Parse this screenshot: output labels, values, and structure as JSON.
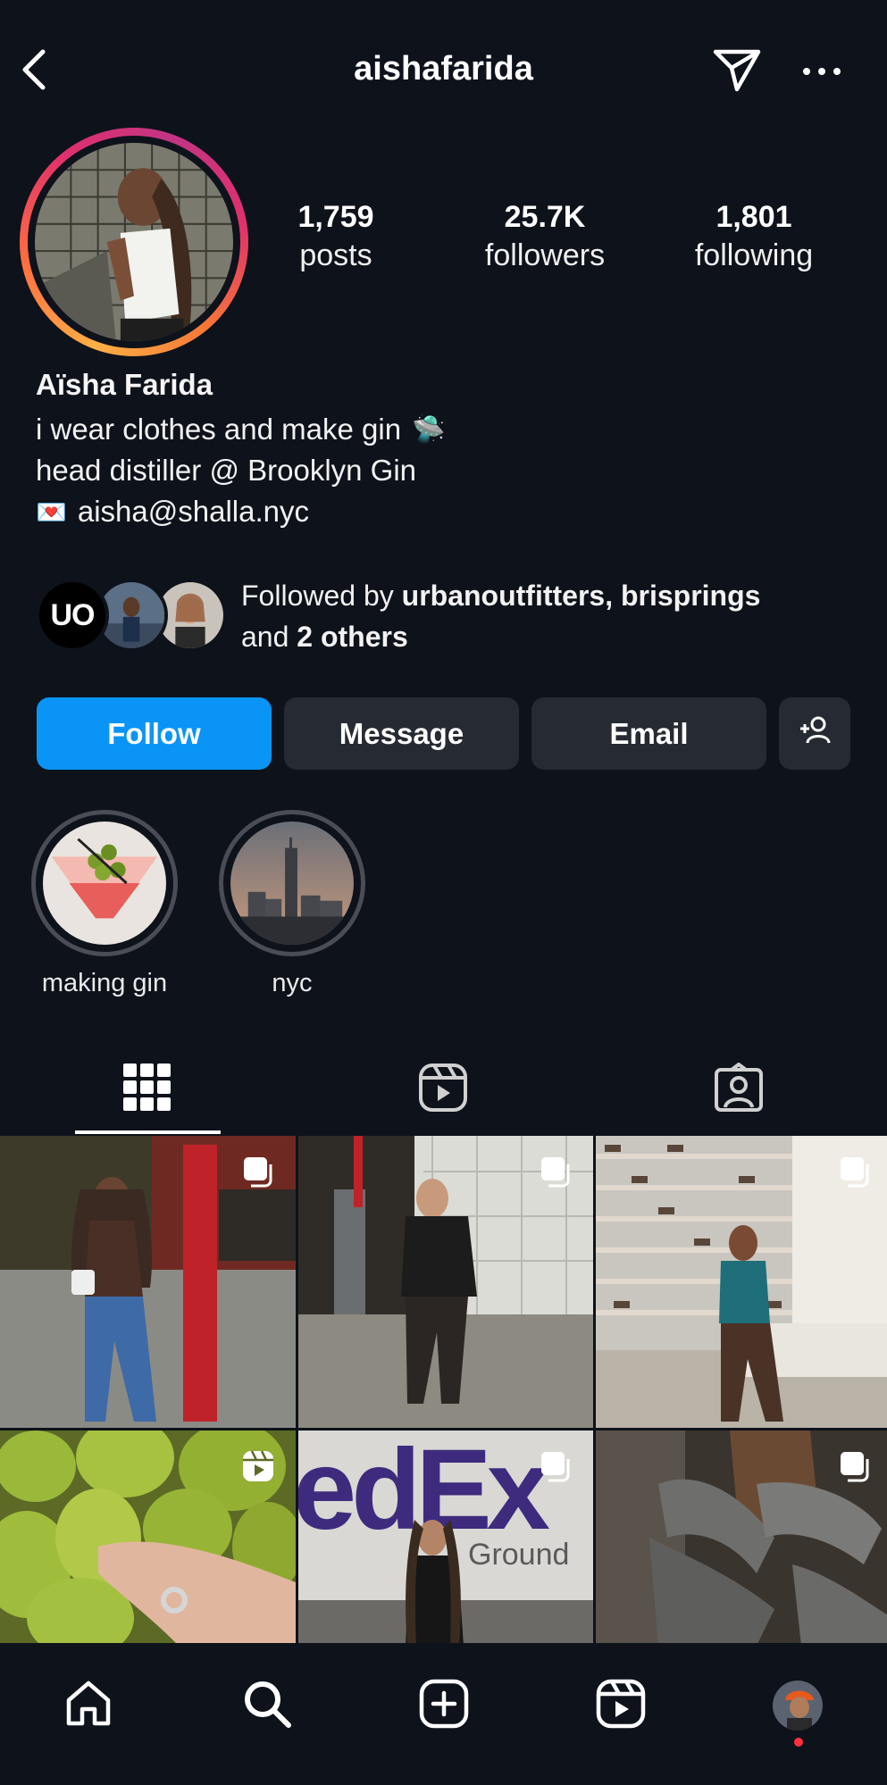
{
  "header": {
    "username": "aishafarida",
    "back_icon": "chevron-left-icon",
    "send_icon": "paper-plane-icon",
    "more_icon": "more-horizontal-icon"
  },
  "profile": {
    "stats": [
      {
        "value": "1,759",
        "label": "posts"
      },
      {
        "value": "25.7K",
        "label": "followers"
      },
      {
        "value": "1,801",
        "label": "following"
      }
    ],
    "display_name": "Aïsha Farida",
    "bio": [
      {
        "text": "i wear clothes and make gin",
        "emoji": "🛸"
      },
      {
        "text": "head distiller @ Brooklyn Gin",
        "emoji": ""
      },
      {
        "text": "aisha@shalla.nyc",
        "emoji": "💌"
      }
    ],
    "story_ring_colors": [
      "#fcaf45",
      "#e1306c",
      "#c13584"
    ]
  },
  "followed_by": {
    "prefix": "Followed by ",
    "names": "urbanoutfitters, brisprings",
    "and": " and ",
    "others": "2 others",
    "uo_logo": "UO"
  },
  "buttons": {
    "follow": "Follow",
    "message": "Message",
    "email": "Email",
    "add_user_icon": "add-user-icon",
    "follow_color": "#0a95f6"
  },
  "highlights": [
    {
      "label": "making gin"
    },
    {
      "label": "nyc"
    }
  ],
  "tabs": [
    {
      "icon": "grid-icon",
      "active": true
    },
    {
      "icon": "reels-icon",
      "active": false
    },
    {
      "icon": "tagged-icon",
      "active": false
    }
  ],
  "grid": {
    "posts": [
      {
        "badge": "carousel-icon"
      },
      {
        "badge": "carousel-icon"
      },
      {
        "badge": "carousel-icon"
      },
      {
        "badge": "reel-icon"
      },
      {
        "badge": "carousel-icon"
      },
      {
        "badge": "carousel-icon"
      }
    ],
    "fedex_text": "edEx",
    "ground_text": "Ground"
  },
  "nav": {
    "items": [
      "home-icon",
      "search-icon",
      "create-icon",
      "reels-icon",
      "profile-avatar"
    ],
    "notification_color": "#ff3040"
  }
}
